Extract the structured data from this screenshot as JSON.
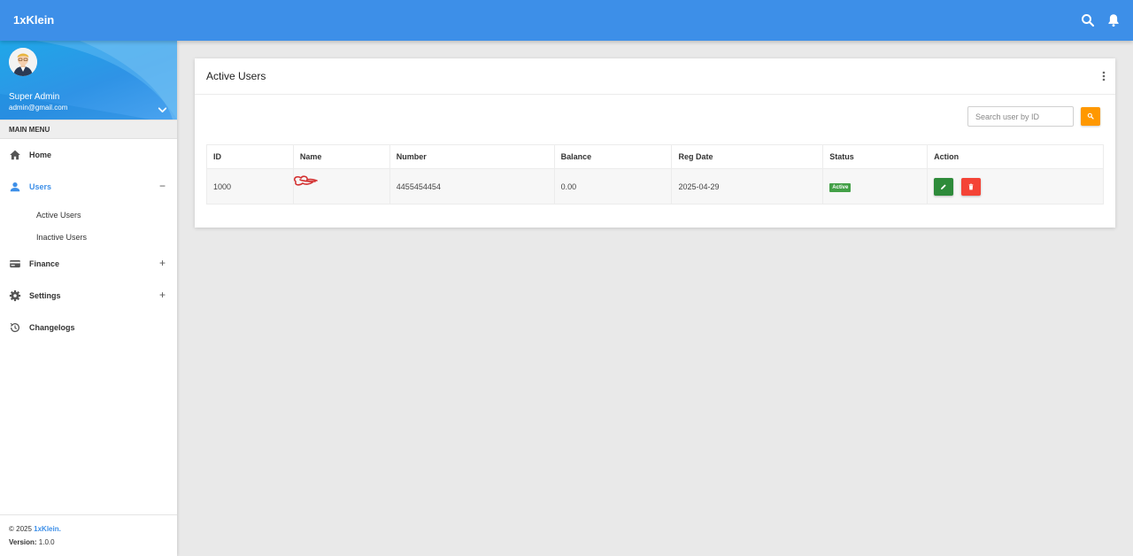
{
  "app": {
    "title": "1xKlein"
  },
  "topbar": {
    "icons": [
      "search-icon",
      "bell-icon"
    ]
  },
  "sidebar": {
    "profile": {
      "name": "Super Admin",
      "email": "admin@gmail.com"
    },
    "menu_header": "MAIN MENU",
    "items": [
      {
        "label": "Home",
        "icon": "home-icon"
      },
      {
        "label": "Users",
        "icon": "user-icon",
        "active": true,
        "sign": "−",
        "children": [
          {
            "label": "Active Users"
          },
          {
            "label": "Inactive Users"
          }
        ]
      },
      {
        "label": "Finance",
        "icon": "card-icon",
        "sign": "+"
      },
      {
        "label": "Settings",
        "icon": "gear-icon",
        "sign": "+"
      },
      {
        "label": "Changelogs",
        "icon": "history-icon"
      }
    ],
    "footer": {
      "copyright_prefix": "© 2025 ",
      "copyright_brand": "1xKlein.",
      "version_label": "Version:",
      "version_value": " 1.0.0"
    }
  },
  "main": {
    "card_title": "Active Users",
    "search": {
      "placeholder": "Search user by ID"
    },
    "table": {
      "columns": [
        "ID",
        "Name",
        "Number",
        "Balance",
        "Reg Date",
        "Status",
        "Action"
      ],
      "rows": [
        {
          "id": "1000",
          "name": "",
          "number": "4455454454",
          "balance": "0.00",
          "reg_date": "2025-04-29",
          "status": "Active"
        }
      ]
    }
  },
  "colors": {
    "primary": "#3d8fe8",
    "search_button": "#ff9800",
    "edit": "#2e8b3a",
    "delete": "#f44336",
    "status_active": "#43a047"
  }
}
